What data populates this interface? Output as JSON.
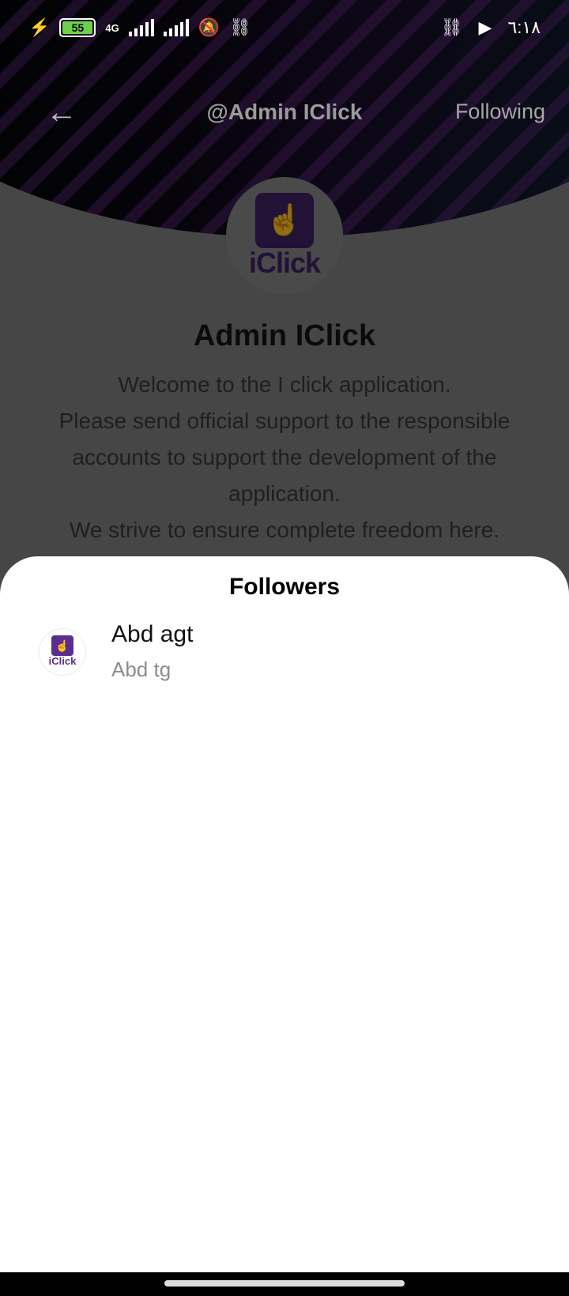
{
  "status_bar": {
    "battery": "55",
    "network": "4G",
    "time": "٦:١٨"
  },
  "topbar": {
    "handle": "@Admin IClick",
    "following_label": "Following"
  },
  "profile": {
    "logo_text": "iClick",
    "name": "Admin IClick",
    "bio": [
      "Welcome to the I click application.",
      "Please send official support to the responsible accounts to support the development of the application.",
      "We strive to ensure complete freedom here."
    ]
  },
  "followers_sheet": {
    "title": "Followers",
    "items": [
      {
        "name": "Abd agt",
        "username": "Abd tg",
        "avatar_text": "iClick"
      }
    ]
  },
  "colors": {
    "brand_purple": "#3d2163",
    "battery_green": "#6dd14b"
  }
}
